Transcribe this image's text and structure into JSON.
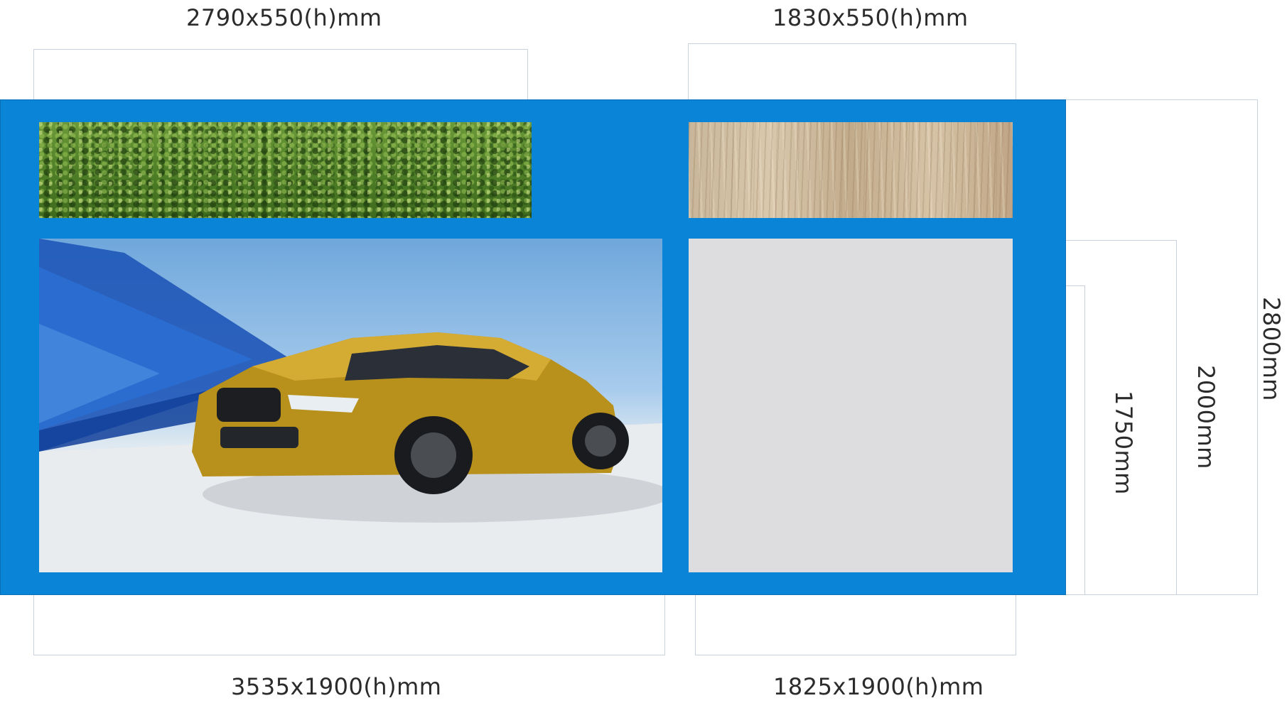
{
  "dimensions": {
    "top_left": "2790x550(h)mm",
    "top_right": "1830x550(h)mm",
    "bottom_left": "3535x1900(h)mm",
    "bottom_right": "1825x1900(h)mm",
    "height_total": "2800mm",
    "height_2000": "2000mm",
    "height_1750": "1750mm"
  },
  "panels": {
    "grass": "green-hedge-texture",
    "wood": "light-wood-texture",
    "photo": "gold-sedan-photo",
    "blank": "blank-grey-panel"
  },
  "colors": {
    "wall": "#0a84d6",
    "blank_panel": "#dddddf",
    "guide_lines": "#c7d2dc"
  }
}
